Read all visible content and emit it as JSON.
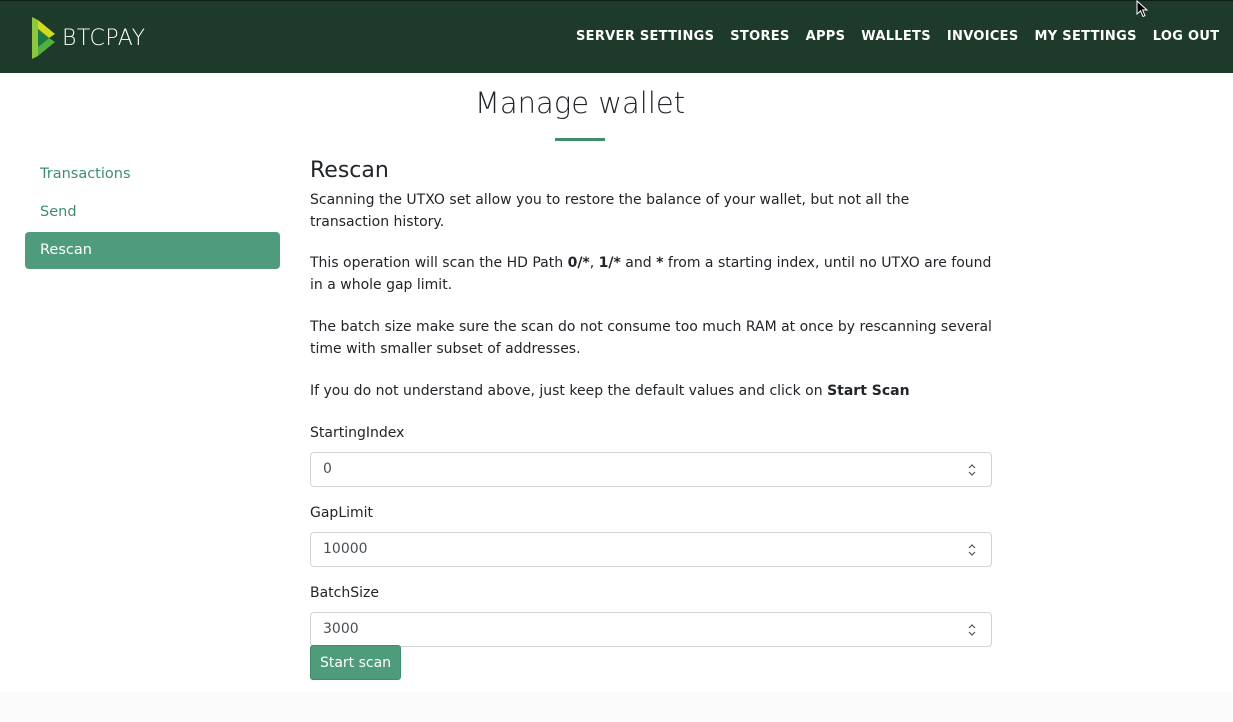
{
  "header": {
    "brand": "BTCPAY",
    "nav": [
      "SERVER SETTINGS",
      "STORES",
      "APPS",
      "WALLETS",
      "INVOICES",
      "MY SETTINGS",
      "LOG OUT"
    ]
  },
  "page": {
    "title": "Manage wallet"
  },
  "sidebar": {
    "items": [
      {
        "label": "Transactions"
      },
      {
        "label": "Send"
      },
      {
        "label": "Rescan"
      }
    ]
  },
  "main": {
    "section_title": "Rescan",
    "p1": "Scanning the UTXO set allow you to restore the balance of your wallet, but not all the transaction history.",
    "p2_a": "This operation will scan the HD Path ",
    "p2_b": "0/*",
    "p2_c": ", ",
    "p2_d": "1/*",
    "p2_e": " and ",
    "p2_f": "*",
    "p2_g": " from a starting index, until no UTXO are found in a whole gap limit.",
    "p3": "The batch size make sure the scan do not consume too much RAM at once by rescanning several time with smaller subset of addresses.",
    "p4_a": "If you do not understand above, just keep the default values and click on ",
    "p4_b": "Start Scan",
    "fields": [
      {
        "label": "StartingIndex",
        "value": "0"
      },
      {
        "label": "GapLimit",
        "value": "10000"
      },
      {
        "label": "BatchSize",
        "value": "3000"
      }
    ],
    "start_button": "Start scan"
  },
  "colors": {
    "header_bg": "#1e3a2b",
    "accent": "#4f9c7d",
    "link": "#3e8e6c"
  },
  "icons": [
    "btcpay-logo-icon",
    "mouse-cursor-icon",
    "number-spinner-icon"
  ]
}
